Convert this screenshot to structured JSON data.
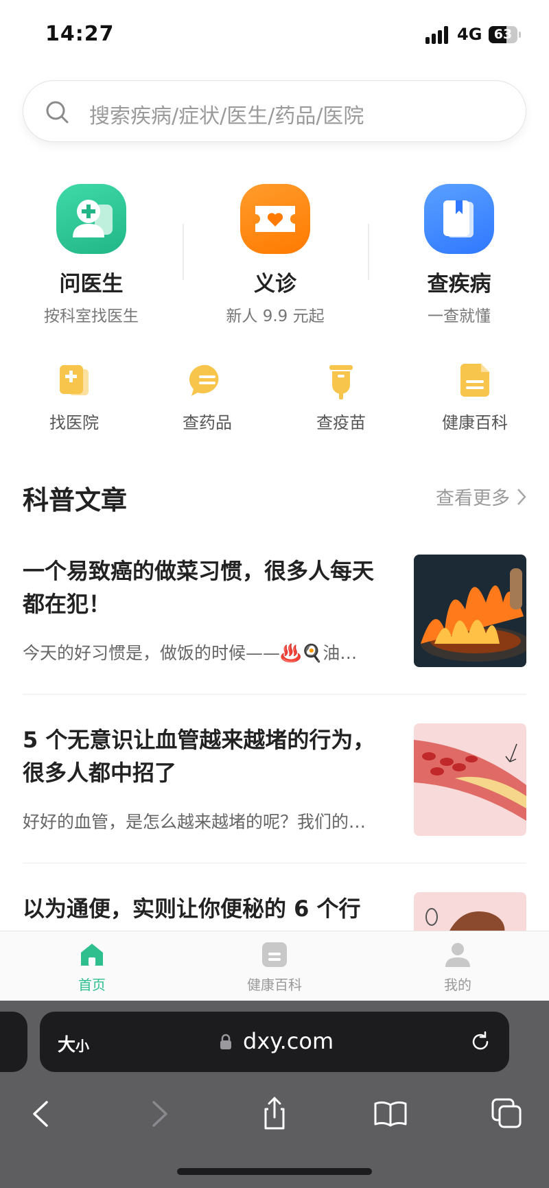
{
  "status_bar": {
    "time": "14:27",
    "network": "4G",
    "battery": "63",
    "battery_level": 0.63
  },
  "search": {
    "placeholder": "搜索疾病/症状/医生/药品/医院"
  },
  "main_services": [
    {
      "title": "问医生",
      "subtitle": "按科室找医生",
      "icon": "doctor-icon",
      "color": "#2ec79a"
    },
    {
      "title": "义诊",
      "subtitle": "新人 9.9 元起",
      "icon": "ticket-heart-icon",
      "color": "#ff8a12"
    },
    {
      "title": "查疾病",
      "subtitle": "一查就懂",
      "icon": "book-icon",
      "color": "#3f8cff"
    }
  ],
  "mini_services": [
    {
      "label": "找医院",
      "icon": "hospital-doc-icon"
    },
    {
      "label": "查药品",
      "icon": "pill-chat-icon"
    },
    {
      "label": "查疫苗",
      "icon": "vaccine-icon"
    },
    {
      "label": "健康百科",
      "icon": "encyclopedia-icon"
    }
  ],
  "articles_section": {
    "title": "科普文章",
    "more_label": "查看更多"
  },
  "articles": [
    {
      "title": "一个易致癌的做菜习惯，很多人每天都在犯！",
      "desc": "今天的好习惯是，做饭的时候——♨️🍳油…",
      "thumb": "cooking-flame-image"
    },
    {
      "title": "5 个无意识让血管越来越堵的行为，很多人都中招了",
      "desc": "好好的血管，是怎么越来越堵的呢？我们的…",
      "thumb": "blood-vessel-image"
    },
    {
      "title": "以为通便，实则让你便秘的 6 个行",
      "desc": "",
      "thumb": "stomach-image"
    }
  ],
  "tabbar": [
    {
      "label": "首页",
      "icon": "home-icon",
      "active": true
    },
    {
      "label": "健康百科",
      "icon": "document-icon",
      "active": false
    },
    {
      "label": "我的",
      "icon": "person-icon",
      "active": false
    }
  ],
  "browser": {
    "text_size_label": "大",
    "text_size_small": "小",
    "host": "dxy.com"
  },
  "colors": {
    "accent": "#2fbf8f",
    "mini_icon": "#f7c54b"
  }
}
